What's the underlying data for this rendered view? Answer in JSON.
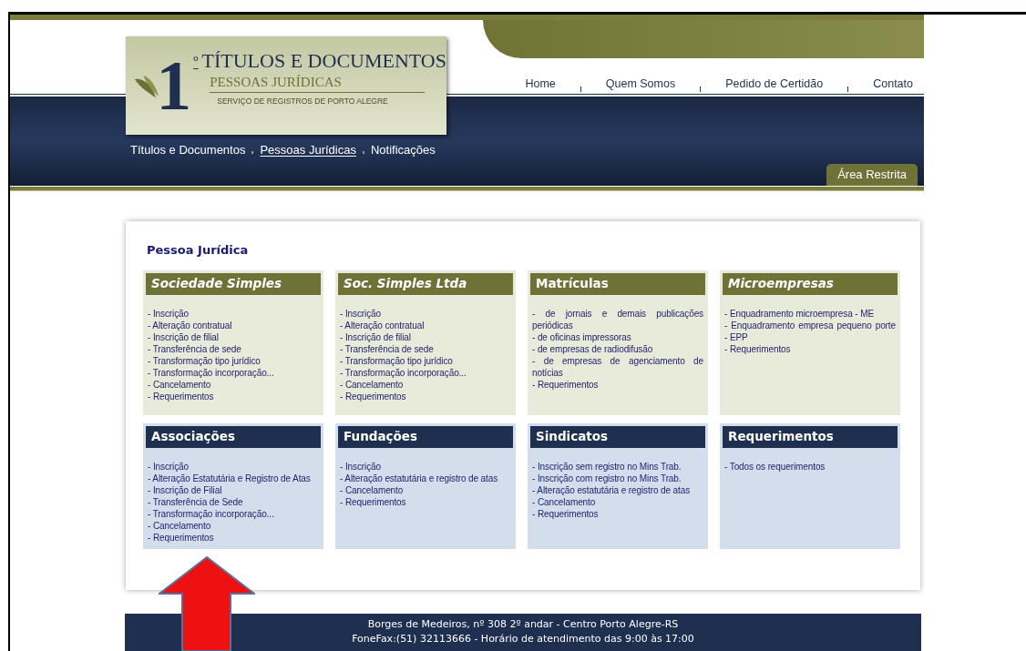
{
  "logo": {
    "numeral": "1",
    "ordinal": "º",
    "title": "TÍTULOS E DOCUMENTOS",
    "subtitle": "PESSOAS JURÍDICAS",
    "tagline": "SERVIÇO DE REGISTROS DE PORTO ALEGRE"
  },
  "main_nav": [
    "Home",
    "Quem Somos",
    "Pedido de Certidão",
    "Contato"
  ],
  "sub_nav": [
    {
      "label": "Títulos e Documentos",
      "selected": false
    },
    {
      "label": "Pessoas Jurídicas",
      "selected": true
    },
    {
      "label": "Notificações",
      "selected": false
    }
  ],
  "restricted_tab": "Área Restrita",
  "page_title": "Pessoa Jurídica",
  "rows": [
    {
      "kind": "olive",
      "sections": [
        {
          "title": "Sociedade Simples",
          "italic": true,
          "items": [
            "- Inscrição",
            "- Alteração contratual",
            "- Inscrição de filial",
            "- Transferência de sede",
            "- Transformação tipo jurídico",
            "- Transformação incorporação...",
            "- Cancelamento",
            "- Requerimentos"
          ]
        },
        {
          "title": "Soc. Simples Ltda",
          "italic": true,
          "items": [
            "- Inscrição",
            "- Alteração contratual",
            "- Inscrição de filial",
            "- Transferência de sede",
            "- Transformação tipo jurídico",
            "- Transformação incorporação...",
            "- Cancelamento",
            "- Requerimentos"
          ]
        },
        {
          "title": "Matrículas",
          "italic": false,
          "items": [
            "- de jornais e demais publicações periódicas",
            "- de oficinas impressoras",
            "- de empresas de radiodifusão",
            "- de empresas de agenciamento de notícias",
            "- Requerimentos"
          ]
        },
        {
          "title": "Microempresas",
          "italic": true,
          "items": [
            "- Enquadramento microempresa - ME",
            "- Enquadramento empresa pequeno porte - EPP",
            "- Requerimentos"
          ]
        }
      ]
    },
    {
      "kind": "navy",
      "sections": [
        {
          "title": "Associações",
          "italic": false,
          "items": [
            "- Inscrição",
            "- Alteração Estatutária e Registro de Atas",
            "- Inscrição de Filial",
            "- Transferência de Sede",
            "- Transformação incorporação...",
            "- Cancelamento",
            "- Requerimentos"
          ]
        },
        {
          "title": "Fundações",
          "italic": false,
          "items": [
            "- Inscrição",
            "- Alteração estatutária e registro de atas",
            "- Cancelamento",
            "- Requerimentos"
          ]
        },
        {
          "title": "Sindicatos",
          "italic": false,
          "items": [
            "- Inscrição sem registro no Mins Trab.",
            "- Inscrição com registro no Mins Trab.",
            "- Alteração estatutária e registro de atas",
            "- Cancelamento",
            "- Requerimentos"
          ]
        },
        {
          "title": "Requerimentos",
          "italic": false,
          "items": [
            "- Todos os requerimentos"
          ]
        }
      ]
    }
  ],
  "footer": [
    "Borges de Medeiros, nº 308 2º andar - Centro Porto Alegre-RS",
    "FoneFax:(51) 32113666 - Horário de atendimento das 9:00 às 17:00"
  ]
}
